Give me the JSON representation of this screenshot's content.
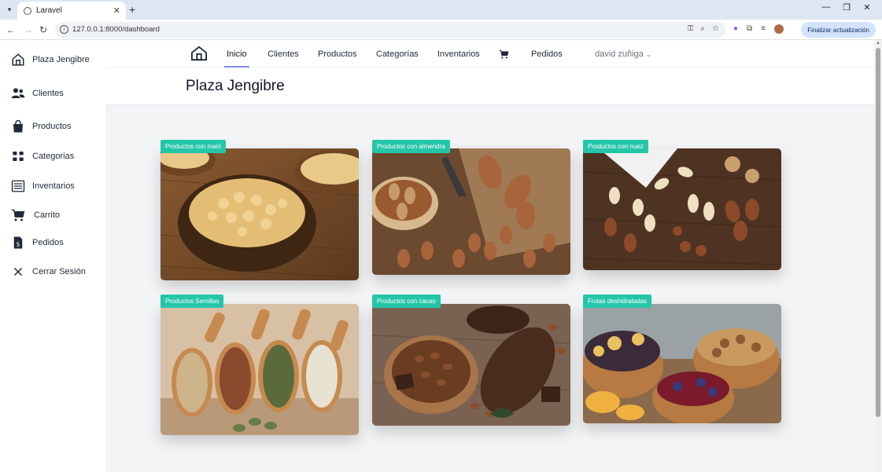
{
  "browser": {
    "tab_title": "Laravel",
    "url": "127.0.0.1:8000/dashboard",
    "update_button": "Finalizar actualización"
  },
  "sidebar": {
    "items": [
      {
        "label": "Plaza Jengibre",
        "icon": "home-icon"
      },
      {
        "label": "Clientes",
        "icon": "users-icon"
      },
      {
        "label": "Productos",
        "icon": "shopping-bag-icon"
      },
      {
        "label": "Categorias",
        "icon": "grid-icon"
      },
      {
        "label": "Inventarios",
        "icon": "list-icon"
      },
      {
        "label": "Carrito",
        "icon": "cart-icon"
      },
      {
        "label": "Pedidos",
        "icon": "receipt-icon"
      },
      {
        "label": "Cerrar Sesión",
        "icon": "close-icon"
      }
    ]
  },
  "topnav": {
    "links": [
      "Inicio",
      "Clientes",
      "Productos",
      "Categorías",
      "Inventarios",
      "Pedidos"
    ],
    "active": "Inicio",
    "user": "david zuñiga"
  },
  "page": {
    "title": "Plaza Jengibre"
  },
  "categories": [
    {
      "tag": "Productos con maní",
      "theme": "peanuts"
    },
    {
      "tag": "Productos con almendra",
      "theme": "almonds"
    },
    {
      "tag": "Productos con nuez",
      "theme": "nuts"
    },
    {
      "tag": "Productos Semillas",
      "theme": "seeds"
    },
    {
      "tag": "Productos con cacao",
      "theme": "cacao"
    },
    {
      "tag": "Frutas deshidratadas",
      "theme": "dried-fruit"
    }
  ],
  "colors": {
    "tag_bg": "#25c6a8",
    "nav_underline": "#818cf8",
    "page_bg": "#f3f4f6"
  }
}
